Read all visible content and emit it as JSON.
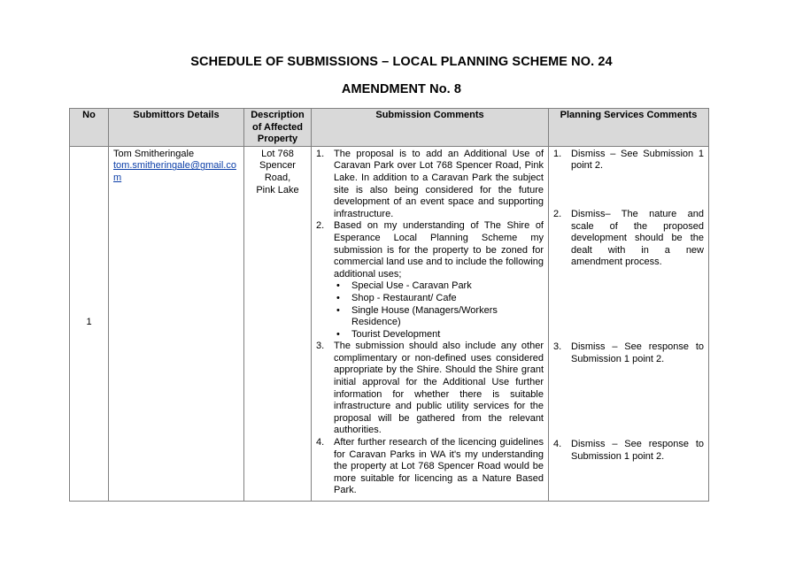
{
  "heading": "SCHEDULE OF SUBMISSIONS – LOCAL PLANNING SCHEME NO. 24",
  "subheading": "AMENDMENT No. 8",
  "columns": [
    "No",
    "Submittors Details",
    "Description of Affected Property",
    "Submission Comments",
    "Planning Services Comments"
  ],
  "row": {
    "no": "1",
    "submitter_name": "Tom Smitheringale",
    "submitter_email": "tom.smitheringale@gmail.com",
    "property": "Lot 768 Spencer Road, Pink Lake",
    "comments": [
      {
        "num": "1.",
        "text": "The proposal is to add an Additional Use of Caravan Park over Lot 768 Spencer Road, Pink Lake. In addition to a Caravan Park the subject site is also being considered for the future development of an event space and supporting infrastructure."
      },
      {
        "num": "2.",
        "text": "Based on my understanding of The Shire of Esperance Local Planning Scheme my submission is for the property to be zoned for commercial land use and to include the following additional uses;",
        "bullets": [
          "Special Use - Caravan Park",
          "Shop - Restaurant/ Cafe",
          "Single House (Managers/Workers Residence)",
          "Tourist Development"
        ]
      },
      {
        "num": "3.",
        "text": "The submission should also include any other complimentary or non-defined uses considered appropriate by the Shire. Should the Shire grant initial approval for the Additional Use further information for whether there is suitable infrastructure and public utility services for the proposal will be gathered from the relevant authorities."
      },
      {
        "num": "4.",
        "text": "After further research of the licencing guidelines for Caravan Parks in WA it's my understanding the property at Lot 768 Spencer Road would be more suitable for licencing as a Nature Based Park."
      }
    ],
    "planning": [
      {
        "num": "1.",
        "text": "Dismiss – See Submission 1 point 2."
      },
      {
        "num": "2.",
        "text": "Dismiss– The nature and scale of the proposed development should be the dealt with in a new amendment process."
      },
      {
        "num": "3.",
        "text": "Dismiss – See response to Submission 1 point 2."
      },
      {
        "num": "4.",
        "text": "Dismiss – See response to Submission 1 point 2."
      }
    ]
  }
}
